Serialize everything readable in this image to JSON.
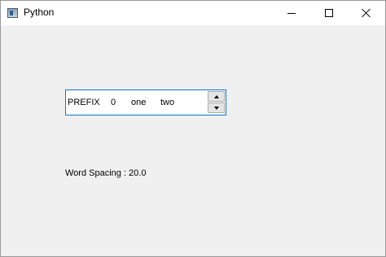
{
  "window": {
    "title": "Python",
    "icons": {
      "app": "python-window-icon",
      "minimize": "minimize-icon",
      "maximize": "maximize-icon",
      "close": "close-icon"
    }
  },
  "spinbox": {
    "prefix": "PREFIX",
    "value": "0",
    "word1": "one",
    "word2": "two",
    "up_icon": "arrow-up-icon",
    "down_icon": "arrow-down-icon",
    "focus_color": "#0078d7"
  },
  "label": {
    "text": "Word Spacing : 20.0"
  }
}
